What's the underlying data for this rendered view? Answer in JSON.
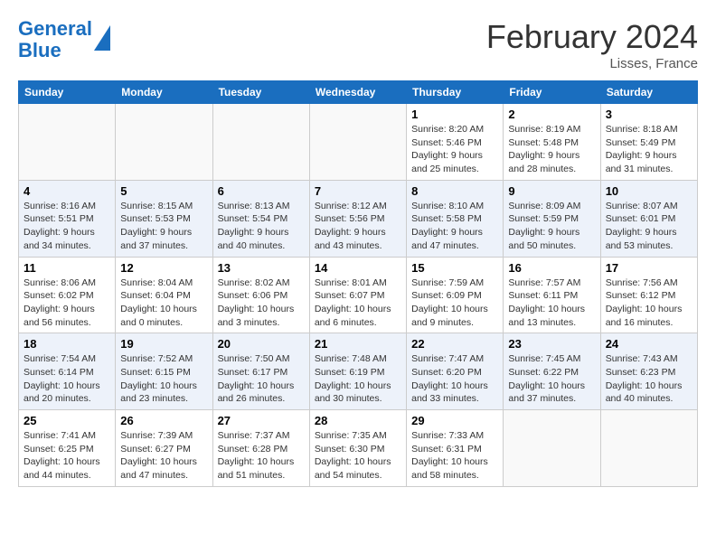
{
  "header": {
    "logo_line1": "General",
    "logo_line2": "Blue",
    "month": "February 2024",
    "location": "Lisses, France"
  },
  "days_of_week": [
    "Sunday",
    "Monday",
    "Tuesday",
    "Wednesday",
    "Thursday",
    "Friday",
    "Saturday"
  ],
  "weeks": [
    [
      {
        "day": "",
        "info": ""
      },
      {
        "day": "",
        "info": ""
      },
      {
        "day": "",
        "info": ""
      },
      {
        "day": "",
        "info": ""
      },
      {
        "day": "1",
        "info": "Sunrise: 8:20 AM\nSunset: 5:46 PM\nDaylight: 9 hours\nand 25 minutes."
      },
      {
        "day": "2",
        "info": "Sunrise: 8:19 AM\nSunset: 5:48 PM\nDaylight: 9 hours\nand 28 minutes."
      },
      {
        "day": "3",
        "info": "Sunrise: 8:18 AM\nSunset: 5:49 PM\nDaylight: 9 hours\nand 31 minutes."
      }
    ],
    [
      {
        "day": "4",
        "info": "Sunrise: 8:16 AM\nSunset: 5:51 PM\nDaylight: 9 hours\nand 34 minutes."
      },
      {
        "day": "5",
        "info": "Sunrise: 8:15 AM\nSunset: 5:53 PM\nDaylight: 9 hours\nand 37 minutes."
      },
      {
        "day": "6",
        "info": "Sunrise: 8:13 AM\nSunset: 5:54 PM\nDaylight: 9 hours\nand 40 minutes."
      },
      {
        "day": "7",
        "info": "Sunrise: 8:12 AM\nSunset: 5:56 PM\nDaylight: 9 hours\nand 43 minutes."
      },
      {
        "day": "8",
        "info": "Sunrise: 8:10 AM\nSunset: 5:58 PM\nDaylight: 9 hours\nand 47 minutes."
      },
      {
        "day": "9",
        "info": "Sunrise: 8:09 AM\nSunset: 5:59 PM\nDaylight: 9 hours\nand 50 minutes."
      },
      {
        "day": "10",
        "info": "Sunrise: 8:07 AM\nSunset: 6:01 PM\nDaylight: 9 hours\nand 53 minutes."
      }
    ],
    [
      {
        "day": "11",
        "info": "Sunrise: 8:06 AM\nSunset: 6:02 PM\nDaylight: 9 hours\nand 56 minutes."
      },
      {
        "day": "12",
        "info": "Sunrise: 8:04 AM\nSunset: 6:04 PM\nDaylight: 10 hours\nand 0 minutes."
      },
      {
        "day": "13",
        "info": "Sunrise: 8:02 AM\nSunset: 6:06 PM\nDaylight: 10 hours\nand 3 minutes."
      },
      {
        "day": "14",
        "info": "Sunrise: 8:01 AM\nSunset: 6:07 PM\nDaylight: 10 hours\nand 6 minutes."
      },
      {
        "day": "15",
        "info": "Sunrise: 7:59 AM\nSunset: 6:09 PM\nDaylight: 10 hours\nand 9 minutes."
      },
      {
        "day": "16",
        "info": "Sunrise: 7:57 AM\nSunset: 6:11 PM\nDaylight: 10 hours\nand 13 minutes."
      },
      {
        "day": "17",
        "info": "Sunrise: 7:56 AM\nSunset: 6:12 PM\nDaylight: 10 hours\nand 16 minutes."
      }
    ],
    [
      {
        "day": "18",
        "info": "Sunrise: 7:54 AM\nSunset: 6:14 PM\nDaylight: 10 hours\nand 20 minutes."
      },
      {
        "day": "19",
        "info": "Sunrise: 7:52 AM\nSunset: 6:15 PM\nDaylight: 10 hours\nand 23 minutes."
      },
      {
        "day": "20",
        "info": "Sunrise: 7:50 AM\nSunset: 6:17 PM\nDaylight: 10 hours\nand 26 minutes."
      },
      {
        "day": "21",
        "info": "Sunrise: 7:48 AM\nSunset: 6:19 PM\nDaylight: 10 hours\nand 30 minutes."
      },
      {
        "day": "22",
        "info": "Sunrise: 7:47 AM\nSunset: 6:20 PM\nDaylight: 10 hours\nand 33 minutes."
      },
      {
        "day": "23",
        "info": "Sunrise: 7:45 AM\nSunset: 6:22 PM\nDaylight: 10 hours\nand 37 minutes."
      },
      {
        "day": "24",
        "info": "Sunrise: 7:43 AM\nSunset: 6:23 PM\nDaylight: 10 hours\nand 40 minutes."
      }
    ],
    [
      {
        "day": "25",
        "info": "Sunrise: 7:41 AM\nSunset: 6:25 PM\nDaylight: 10 hours\nand 44 minutes."
      },
      {
        "day": "26",
        "info": "Sunrise: 7:39 AM\nSunset: 6:27 PM\nDaylight: 10 hours\nand 47 minutes."
      },
      {
        "day": "27",
        "info": "Sunrise: 7:37 AM\nSunset: 6:28 PM\nDaylight: 10 hours\nand 51 minutes."
      },
      {
        "day": "28",
        "info": "Sunrise: 7:35 AM\nSunset: 6:30 PM\nDaylight: 10 hours\nand 54 minutes."
      },
      {
        "day": "29",
        "info": "Sunrise: 7:33 AM\nSunset: 6:31 PM\nDaylight: 10 hours\nand 58 minutes."
      },
      {
        "day": "",
        "info": ""
      },
      {
        "day": "",
        "info": ""
      }
    ]
  ]
}
